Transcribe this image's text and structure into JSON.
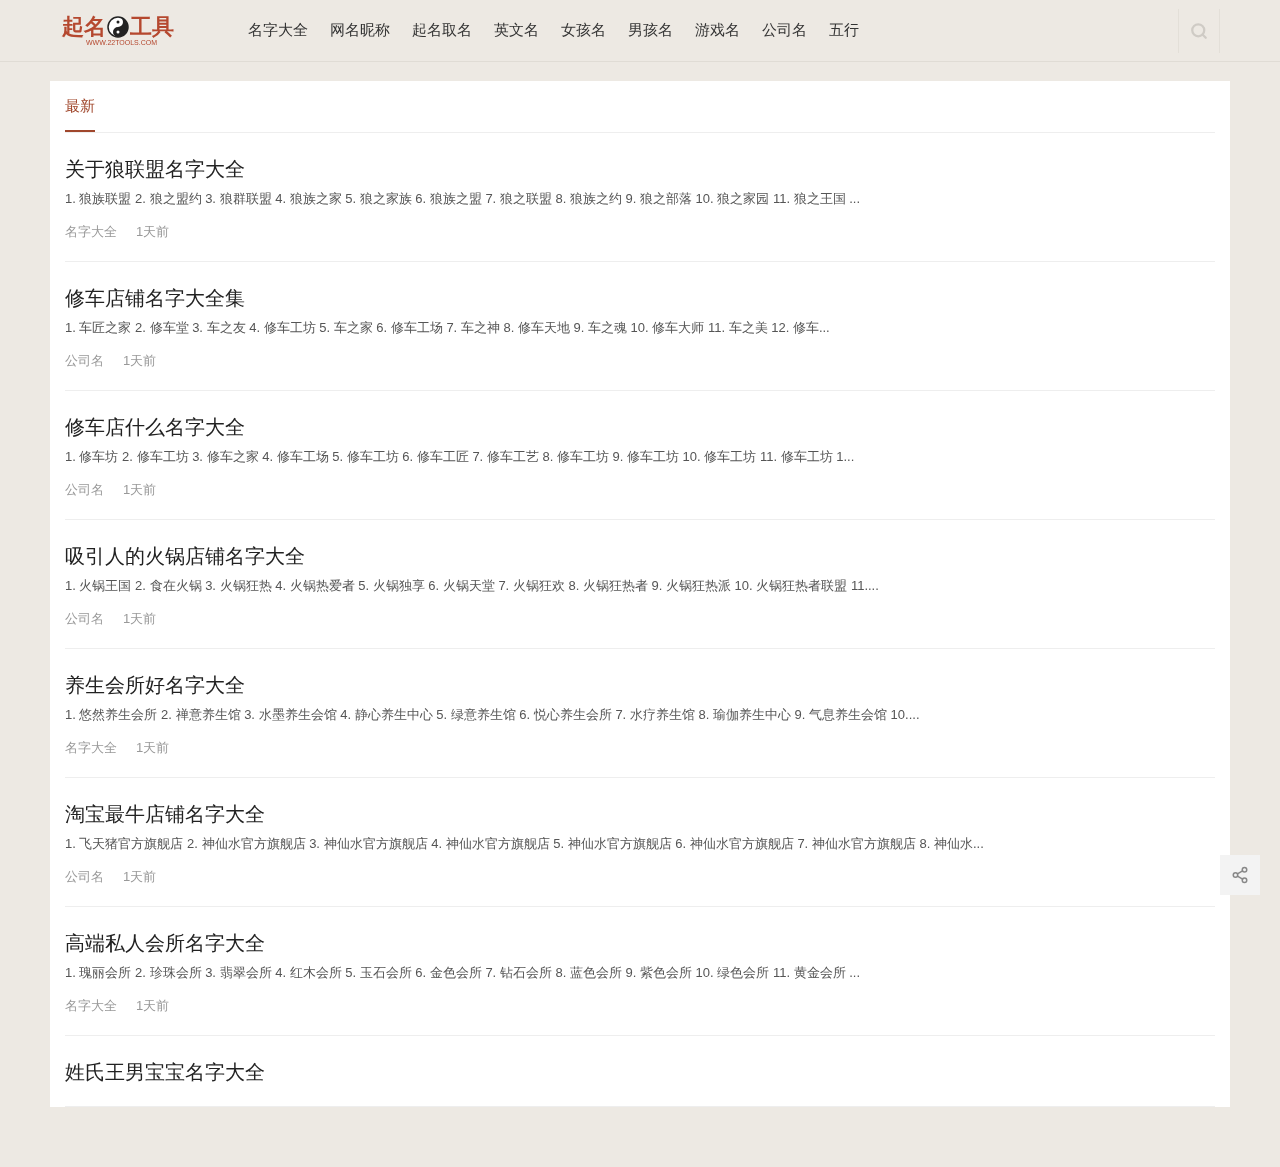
{
  "logo": {
    "left": "起名",
    "right": "工具",
    "url": "WWW.22TOOLS.COM"
  },
  "nav": [
    "名字大全",
    "网名昵称",
    "起名取名",
    "英文名",
    "女孩名",
    "男孩名",
    "游戏名",
    "公司名",
    "五行"
  ],
  "tabs": [
    {
      "label": "最新",
      "selected": true
    }
  ],
  "articles": [
    {
      "title": "关于狼联盟名字大全",
      "excerpt": "1. 狼族联盟 2. 狼之盟约 3. 狼群联盟 4. 狼族之家 5. 狼之家族 6. 狼族之盟 7. 狼之联盟 8. 狼族之约 9. 狼之部落 10. 狼之家园 11. 狼之王国 ...",
      "category": "名字大全",
      "time": "1天前"
    },
    {
      "title": "修车店铺名字大全集",
      "excerpt": "1. 车匠之家 2. 修车堂 3. 车之友 4. 修车工坊 5. 车之家 6. 修车工场 7. 车之神 8. 修车天地 9. 车之魂 10. 修车大师 11. 车之美 12. 修车...",
      "category": "公司名",
      "time": "1天前"
    },
    {
      "title": "修车店什么名字大全",
      "excerpt": "1. 修车坊 2. 修车工坊 3. 修车之家 4. 修车工场 5. 修车工坊 6. 修车工匠 7. 修车工艺 8. 修车工坊 9. 修车工坊 10. 修车工坊 11. 修车工坊 1...",
      "category": "公司名",
      "time": "1天前"
    },
    {
      "title": "吸引人的火锅店铺名字大全",
      "excerpt": "1. 火锅王国 2. 食在火锅 3. 火锅狂热 4. 火锅热爱者 5. 火锅独享 6. 火锅天堂 7. 火锅狂欢 8. 火锅狂热者 9. 火锅狂热派 10. 火锅狂热者联盟 11....",
      "category": "公司名",
      "time": "1天前"
    },
    {
      "title": "养生会所好名字大全",
      "excerpt": "1. 悠然养生会所 2. 禅意养生馆 3. 水墨养生会馆 4. 静心养生中心 5. 绿意养生馆 6. 悦心养生会所 7. 水疗养生馆 8. 瑜伽养生中心 9. 气息养生会馆 10....",
      "category": "名字大全",
      "time": "1天前"
    },
    {
      "title": "淘宝最牛店铺名字大全",
      "excerpt": "1. 飞天猪官方旗舰店 2. 神仙水官方旗舰店 3. 神仙水官方旗舰店 4. 神仙水官方旗舰店 5. 神仙水官方旗舰店 6. 神仙水官方旗舰店 7. 神仙水官方旗舰店 8. 神仙水...",
      "category": "公司名",
      "time": "1天前"
    },
    {
      "title": "高端私人会所名字大全",
      "excerpt": "1. 瑰丽会所 2. 珍珠会所 3. 翡翠会所 4. 红木会所 5. 玉石会所 6. 金色会所 7. 钻石会所 8. 蓝色会所 9. 紫色会所 10. 绿色会所 11. 黄金会所 ...",
      "category": "名字大全",
      "time": "1天前"
    },
    {
      "title": "姓氏王男宝宝名字大全"
    }
  ]
}
